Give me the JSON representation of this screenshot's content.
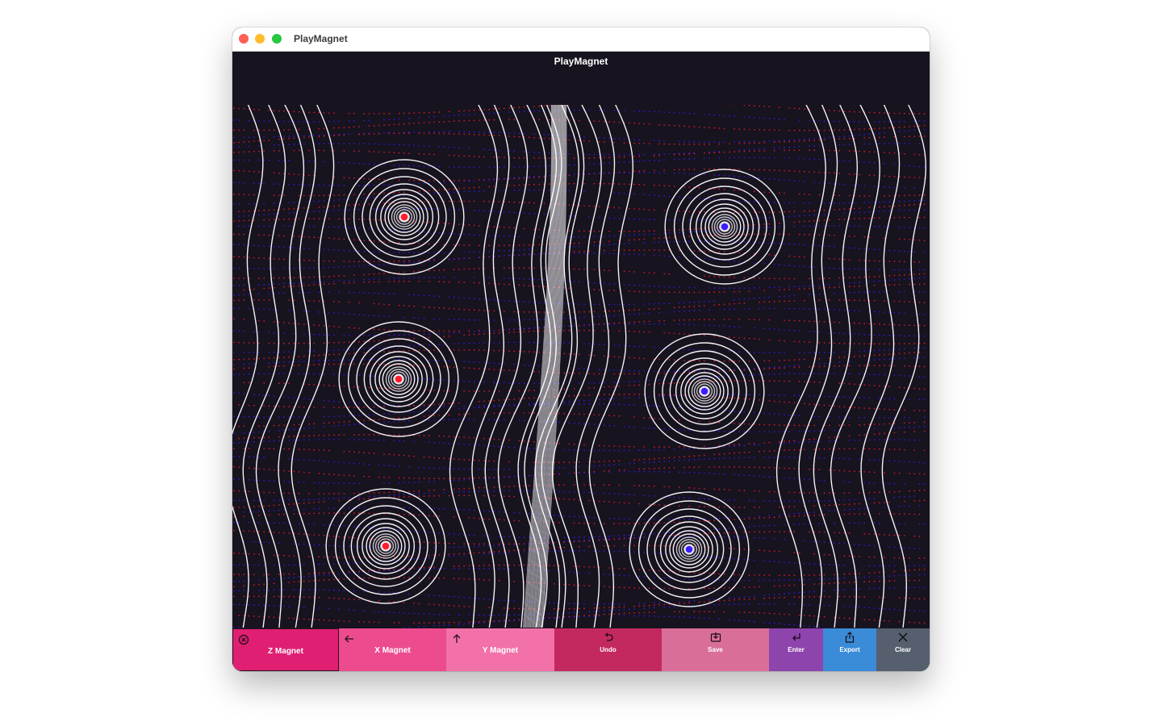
{
  "window": {
    "title": "PlayMagnet"
  },
  "header": {
    "title": "PlayMagnet"
  },
  "canvas": {
    "background": "#17131f",
    "line_color": "#ffffff",
    "north_color": "#ff1e2d",
    "south_color": "#3a1eff",
    "magnets": [
      {
        "polarity": "red",
        "color": "#ff1e2d"
      },
      {
        "polarity": "red",
        "color": "#ff1e2d"
      },
      {
        "polarity": "red",
        "color": "#ff1e2d"
      },
      {
        "polarity": "blue",
        "color": "#3a1eff"
      },
      {
        "polarity": "blue",
        "color": "#3a1eff"
      },
      {
        "polarity": "blue",
        "color": "#3a1eff"
      }
    ]
  },
  "toolbar": {
    "items": [
      {
        "label": "Z Magnet",
        "icon": "circle-x-icon",
        "selected": true,
        "color": "#e01f73"
      },
      {
        "label": "X Magnet",
        "icon": "arrow-left-icon",
        "selected": false,
        "color": "#ec4c8e"
      },
      {
        "label": "Y Magnet",
        "icon": "arrow-up-icon",
        "selected": false,
        "color": "#f271a9"
      },
      {
        "label": "Undo",
        "icon": "undo-icon",
        "selected": false,
        "color": "#c3295f"
      },
      {
        "label": "Save",
        "icon": "save-tray-icon",
        "selected": false,
        "color": "#d96f99"
      },
      {
        "label": "Enter",
        "icon": "return-icon",
        "selected": false,
        "color": "#8e44ad"
      },
      {
        "label": "Export",
        "icon": "share-icon",
        "selected": false,
        "color": "#3a8bd8"
      },
      {
        "label": "Clear",
        "icon": "close-icon",
        "selected": false,
        "color": "#555f6e"
      }
    ]
  }
}
